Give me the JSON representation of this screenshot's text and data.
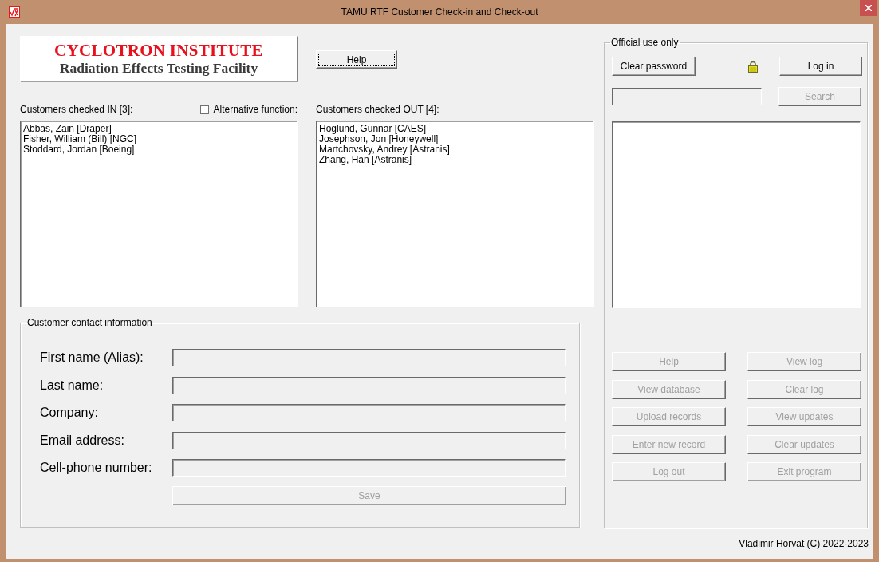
{
  "window": {
    "title": "TAMU RTF Customer Check-in and Check-out"
  },
  "logo": {
    "title": "CYCLOTRON INSTITUTE",
    "subtitle": "Radiation Effects Testing Facility"
  },
  "help_button": {
    "label": "Help",
    "focused": true
  },
  "checked_in": {
    "label": "Customers checked IN [3]:",
    "items": [
      "Abbas, Zain [Draper]",
      "Fisher, William (Bill) [NGC]",
      "Stoddard, Jordan [Boeing]"
    ]
  },
  "alternative_function": {
    "label": "Alternative function:",
    "checked": false
  },
  "checked_out": {
    "label": "Customers checked OUT [4]:",
    "items": [
      "Hoglund, Gunnar [CAES]",
      "Josephson, Jon [Honeywell]",
      "Martchovsky, Andrey [Astranis]",
      "Zhang, Han [Astranis]"
    ]
  },
  "contact": {
    "title": "Customer contact information",
    "fields": [
      {
        "label": "First name (Alias):",
        "disabled": true
      },
      {
        "label": "Last name:",
        "disabled": true
      },
      {
        "label": "Company:",
        "disabled": true
      },
      {
        "label": "Email address:",
        "disabled": true
      },
      {
        "label": "Cell-phone number:",
        "disabled": true
      }
    ],
    "save": {
      "label": "Save",
      "disabled": true
    }
  },
  "official": {
    "title": "Official use only",
    "clear_password": {
      "label": "Clear password",
      "disabled": false
    },
    "locked": true,
    "log_in": {
      "label": "Log in",
      "disabled": false
    },
    "search_field": {
      "disabled": true
    },
    "search": {
      "label": "Search",
      "disabled": true
    },
    "actions": [
      {
        "label": "Help",
        "disabled": true
      },
      {
        "label": "View log",
        "disabled": true
      },
      {
        "label": "View database",
        "disabled": true
      },
      {
        "label": "Clear log",
        "disabled": true
      },
      {
        "label": "Upload records",
        "disabled": true
      },
      {
        "label": "View updates",
        "disabled": true
      },
      {
        "label": "Enter new record",
        "disabled": true
      },
      {
        "label": "Clear updates",
        "disabled": true
      },
      {
        "label": "Log out",
        "disabled": true
      },
      {
        "label": "Exit program",
        "disabled": true
      }
    ]
  },
  "footer": "Vladimir Horvat (C) 2022-2023"
}
